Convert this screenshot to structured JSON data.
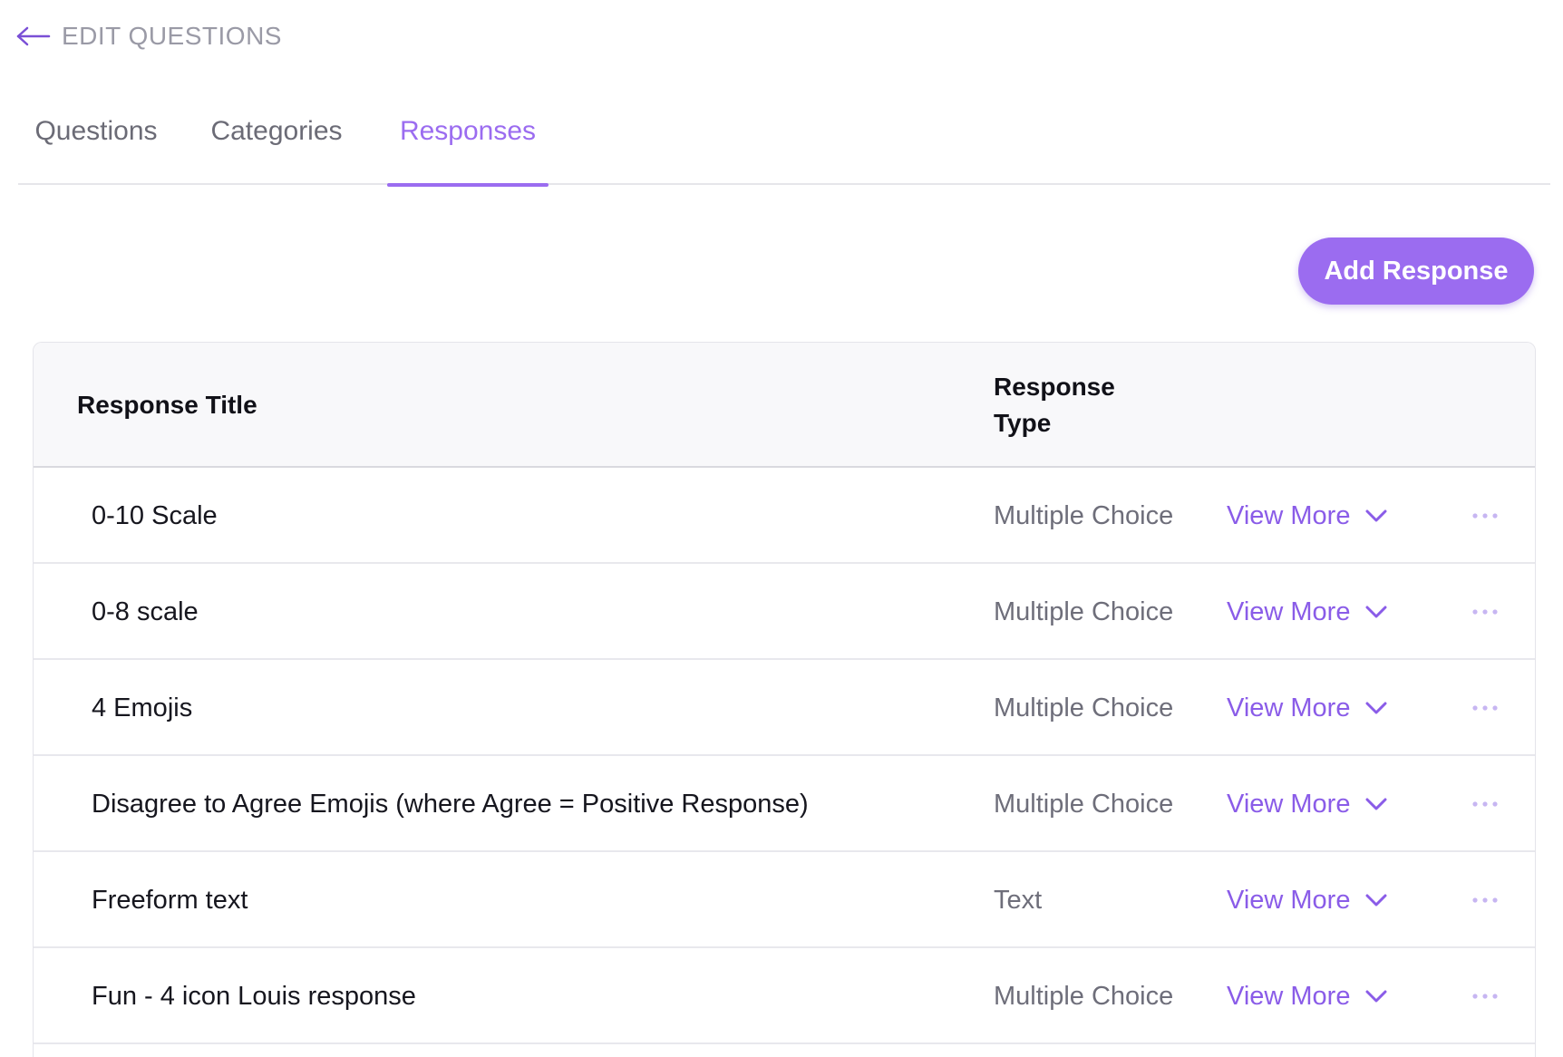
{
  "header": {
    "back_icon": "arrow-left-icon",
    "title": "EDIT QUESTIONS"
  },
  "tabs": [
    {
      "label": "Questions",
      "active": false
    },
    {
      "label": "Categories",
      "active": false
    },
    {
      "label": "Responses",
      "active": true
    }
  ],
  "actions": {
    "add_response_label": "Add Response"
  },
  "colors": {
    "accent": "#9b6cf0",
    "link": "#8a5ce8",
    "muted_text": "#6e6e7a",
    "title_text": "#9a9aa6"
  },
  "table": {
    "columns": {
      "title": "Response Title",
      "type": "Response Type"
    },
    "rows": [
      {
        "title": "0-10 Scale",
        "type": "Multiple Choice",
        "action": "View More",
        "action_icon": "chevron-down-icon",
        "menu_icon": "more-horizontal-icon"
      },
      {
        "title": "0-8 scale",
        "type": "Multiple Choice",
        "action": "View More",
        "action_icon": "chevron-down-icon",
        "menu_icon": "more-horizontal-icon"
      },
      {
        "title": "4 Emojis",
        "type": "Multiple Choice",
        "action": "View More",
        "action_icon": "chevron-down-icon",
        "menu_icon": "more-horizontal-icon"
      },
      {
        "title": "Disagree to Agree Emojis (where Agree = Positive Response)",
        "type": "Multiple Choice",
        "action": "View More",
        "action_icon": "chevron-down-icon",
        "menu_icon": "more-horizontal-icon"
      },
      {
        "title": "Freeform text",
        "type": "Text",
        "action": "View More",
        "action_icon": "chevron-down-icon",
        "menu_icon": "more-horizontal-icon"
      },
      {
        "title": "Fun - 4 icon Louis response",
        "type": "Multiple Choice",
        "action": "View More",
        "action_icon": "chevron-down-icon",
        "menu_icon": "more-horizontal-icon"
      }
    ]
  }
}
